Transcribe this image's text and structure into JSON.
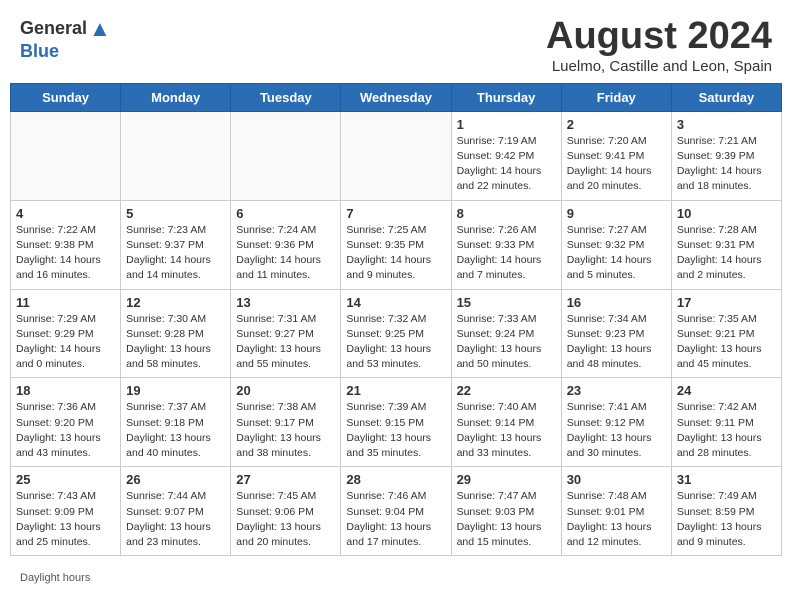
{
  "header": {
    "logo_general": "General",
    "logo_blue": "Blue",
    "title": "August 2024",
    "subtitle": "Luelmo, Castille and Leon, Spain"
  },
  "days_of_week": [
    "Sunday",
    "Monday",
    "Tuesday",
    "Wednesday",
    "Thursday",
    "Friday",
    "Saturday"
  ],
  "weeks": [
    [
      {
        "day": "",
        "info": ""
      },
      {
        "day": "",
        "info": ""
      },
      {
        "day": "",
        "info": ""
      },
      {
        "day": "",
        "info": ""
      },
      {
        "day": "1",
        "info": "Sunrise: 7:19 AM\nSunset: 9:42 PM\nDaylight: 14 hours and 22 minutes."
      },
      {
        "day": "2",
        "info": "Sunrise: 7:20 AM\nSunset: 9:41 PM\nDaylight: 14 hours and 20 minutes."
      },
      {
        "day": "3",
        "info": "Sunrise: 7:21 AM\nSunset: 9:39 PM\nDaylight: 14 hours and 18 minutes."
      }
    ],
    [
      {
        "day": "4",
        "info": "Sunrise: 7:22 AM\nSunset: 9:38 PM\nDaylight: 14 hours and 16 minutes."
      },
      {
        "day": "5",
        "info": "Sunrise: 7:23 AM\nSunset: 9:37 PM\nDaylight: 14 hours and 14 minutes."
      },
      {
        "day": "6",
        "info": "Sunrise: 7:24 AM\nSunset: 9:36 PM\nDaylight: 14 hours and 11 minutes."
      },
      {
        "day": "7",
        "info": "Sunrise: 7:25 AM\nSunset: 9:35 PM\nDaylight: 14 hours and 9 minutes."
      },
      {
        "day": "8",
        "info": "Sunrise: 7:26 AM\nSunset: 9:33 PM\nDaylight: 14 hours and 7 minutes."
      },
      {
        "day": "9",
        "info": "Sunrise: 7:27 AM\nSunset: 9:32 PM\nDaylight: 14 hours and 5 minutes."
      },
      {
        "day": "10",
        "info": "Sunrise: 7:28 AM\nSunset: 9:31 PM\nDaylight: 14 hours and 2 minutes."
      }
    ],
    [
      {
        "day": "11",
        "info": "Sunrise: 7:29 AM\nSunset: 9:29 PM\nDaylight: 14 hours and 0 minutes."
      },
      {
        "day": "12",
        "info": "Sunrise: 7:30 AM\nSunset: 9:28 PM\nDaylight: 13 hours and 58 minutes."
      },
      {
        "day": "13",
        "info": "Sunrise: 7:31 AM\nSunset: 9:27 PM\nDaylight: 13 hours and 55 minutes."
      },
      {
        "day": "14",
        "info": "Sunrise: 7:32 AM\nSunset: 9:25 PM\nDaylight: 13 hours and 53 minutes."
      },
      {
        "day": "15",
        "info": "Sunrise: 7:33 AM\nSunset: 9:24 PM\nDaylight: 13 hours and 50 minutes."
      },
      {
        "day": "16",
        "info": "Sunrise: 7:34 AM\nSunset: 9:23 PM\nDaylight: 13 hours and 48 minutes."
      },
      {
        "day": "17",
        "info": "Sunrise: 7:35 AM\nSunset: 9:21 PM\nDaylight: 13 hours and 45 minutes."
      }
    ],
    [
      {
        "day": "18",
        "info": "Sunrise: 7:36 AM\nSunset: 9:20 PM\nDaylight: 13 hours and 43 minutes."
      },
      {
        "day": "19",
        "info": "Sunrise: 7:37 AM\nSunset: 9:18 PM\nDaylight: 13 hours and 40 minutes."
      },
      {
        "day": "20",
        "info": "Sunrise: 7:38 AM\nSunset: 9:17 PM\nDaylight: 13 hours and 38 minutes."
      },
      {
        "day": "21",
        "info": "Sunrise: 7:39 AM\nSunset: 9:15 PM\nDaylight: 13 hours and 35 minutes."
      },
      {
        "day": "22",
        "info": "Sunrise: 7:40 AM\nSunset: 9:14 PM\nDaylight: 13 hours and 33 minutes."
      },
      {
        "day": "23",
        "info": "Sunrise: 7:41 AM\nSunset: 9:12 PM\nDaylight: 13 hours and 30 minutes."
      },
      {
        "day": "24",
        "info": "Sunrise: 7:42 AM\nSunset: 9:11 PM\nDaylight: 13 hours and 28 minutes."
      }
    ],
    [
      {
        "day": "25",
        "info": "Sunrise: 7:43 AM\nSunset: 9:09 PM\nDaylight: 13 hours and 25 minutes."
      },
      {
        "day": "26",
        "info": "Sunrise: 7:44 AM\nSunset: 9:07 PM\nDaylight: 13 hours and 23 minutes."
      },
      {
        "day": "27",
        "info": "Sunrise: 7:45 AM\nSunset: 9:06 PM\nDaylight: 13 hours and 20 minutes."
      },
      {
        "day": "28",
        "info": "Sunrise: 7:46 AM\nSunset: 9:04 PM\nDaylight: 13 hours and 17 minutes."
      },
      {
        "day": "29",
        "info": "Sunrise: 7:47 AM\nSunset: 9:03 PM\nDaylight: 13 hours and 15 minutes."
      },
      {
        "day": "30",
        "info": "Sunrise: 7:48 AM\nSunset: 9:01 PM\nDaylight: 13 hours and 12 minutes."
      },
      {
        "day": "31",
        "info": "Sunrise: 7:49 AM\nSunset: 8:59 PM\nDaylight: 13 hours and 9 minutes."
      }
    ]
  ],
  "footer": "Daylight hours"
}
